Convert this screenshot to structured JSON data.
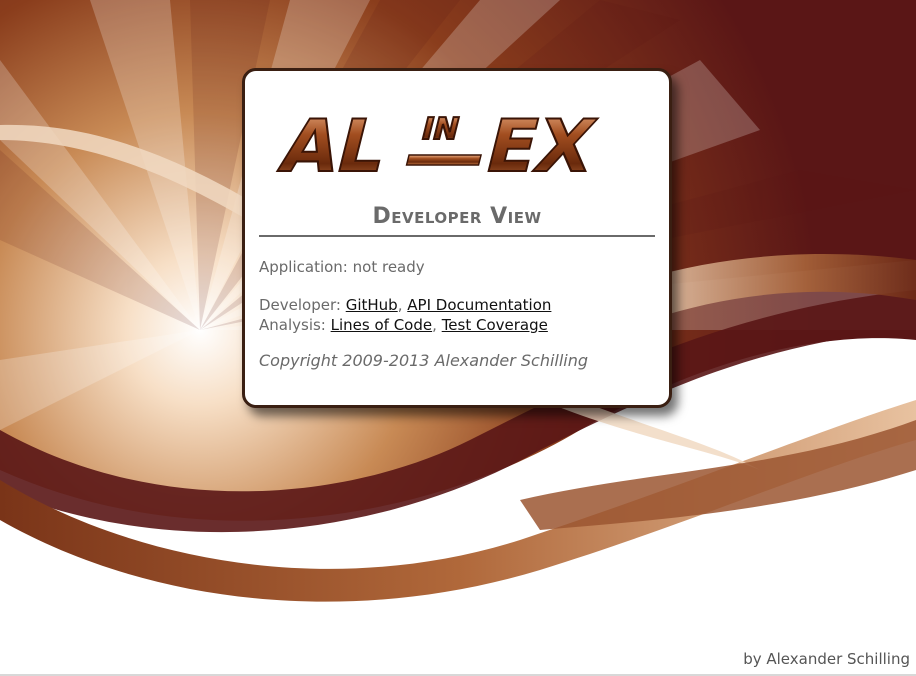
{
  "logo": {
    "text_left": "AL",
    "text_mid": "IN",
    "text_right": "EX"
  },
  "card": {
    "title": "Developer View",
    "status": {
      "label": "Application:",
      "value": "not ready"
    },
    "developer": {
      "label": "Developer:",
      "links": [
        "GitHub",
        "API Documentation"
      ]
    },
    "analysis": {
      "label": "Analysis:",
      "links": [
        "Lines of Code",
        "Test Coverage"
      ]
    },
    "copyright": "Copyright 2009-2013 Alexander Schilling"
  },
  "footer": {
    "credit": "by Alexander Schilling"
  },
  "colors": {
    "brand_brown": "#7a3a1a",
    "dark_maroon": "#5a1515",
    "text_gray": "#6a6a6a"
  }
}
